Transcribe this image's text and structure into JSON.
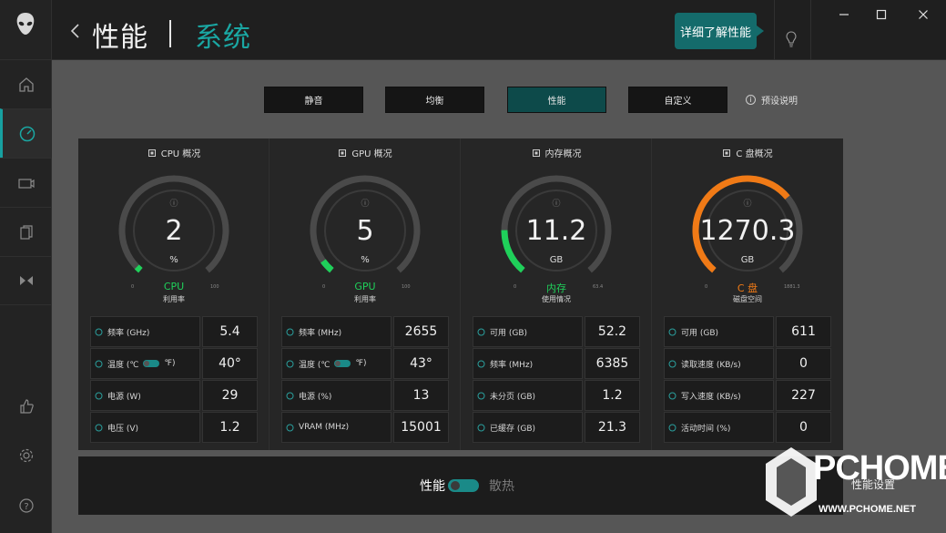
{
  "header": {
    "title": "性能",
    "subtitle": "系统",
    "learn_more": "详细了解性能"
  },
  "sidebar": {
    "items": [
      {
        "name": "home-icon",
        "active": false
      },
      {
        "name": "performance-icon",
        "active": true
      },
      {
        "name": "keyboard-icon",
        "active": false
      },
      {
        "name": "library-icon",
        "active": false
      },
      {
        "name": "audio-icon",
        "active": false
      },
      {
        "name": "thumbs-up-icon",
        "active": false
      },
      {
        "name": "gear-icon",
        "active": false
      },
      {
        "name": "help-icon",
        "active": false
      }
    ]
  },
  "modes": {
    "items": [
      "静音",
      "均衡",
      "性能",
      "自定义"
    ],
    "active": "性能",
    "preset_label": "预设说明"
  },
  "panels": [
    {
      "title": "CPU 概况",
      "value": "2",
      "unit": "%",
      "label": "CPU",
      "sub": "利用率",
      "min": "0",
      "max": "100",
      "fraction": 0.02,
      "color": "#1fd05a",
      "label_color": "#1fd05a",
      "stats": [
        {
          "label": "频率 (GHz)",
          "value": "5.4"
        },
        {
          "label": "温度 (℃",
          "suffix": "℉)",
          "value": "40°"
        },
        {
          "label": "电源 (W)",
          "value": "29"
        },
        {
          "label": "电压 (V)",
          "value": "1.2"
        }
      ]
    },
    {
      "title": "GPU 概况",
      "value": "5",
      "unit": "%",
      "label": "GPU",
      "sub": "利用率",
      "min": "0",
      "max": "100",
      "fraction": 0.05,
      "color": "#1fd05a",
      "label_color": "#1fd05a",
      "stats": [
        {
          "label": "频率 (MHz)",
          "value": "2655"
        },
        {
          "label": "温度 (℃",
          "suffix": "℉)",
          "value": "43°"
        },
        {
          "label": "电源 (%)",
          "value": "13"
        },
        {
          "label": "VRAM (MHz)",
          "value": "15001"
        }
      ]
    },
    {
      "title": "内存概况",
      "value": "11.2",
      "unit": "GB",
      "label": "内存",
      "sub": "使用情况",
      "min": "0",
      "max": "63.4",
      "fraction": 0.18,
      "color": "#1fd05a",
      "label_color": "#1fd05a",
      "stats": [
        {
          "label": "可用 (GB)",
          "value": "52.2"
        },
        {
          "label": "频率 (MHz)",
          "value": "6385"
        },
        {
          "label": "未分页 (GB)",
          "value": "1.2"
        },
        {
          "label": "已缓存 (GB)",
          "value": "21.3"
        }
      ]
    },
    {
      "title": "C 盘概况",
      "value": "1270.3",
      "unit": "GB",
      "label": "C 盘",
      "sub": "磁盘空间",
      "min": "0",
      "max": "1881.3",
      "fraction": 0.68,
      "color": "#f07a16",
      "label_color": "#f07a16",
      "stats": [
        {
          "label": "可用 (GB)",
          "value": "611"
        },
        {
          "label": "读取速度 (KB/s)",
          "value": "0"
        },
        {
          "label": "写入速度 (KB/s)",
          "value": "227"
        },
        {
          "label": "活动时间 (%)",
          "value": "0"
        }
      ]
    }
  ],
  "bottom": {
    "left": "性能",
    "right": "散热",
    "toggle_on": true
  },
  "watermark": {
    "brand": "PCHOME",
    "url": "WWW.PCHOME.NET",
    "extra": "性能设置"
  },
  "colors": {
    "accent": "#1aa7a3",
    "accent_dark": "#146b6b"
  }
}
